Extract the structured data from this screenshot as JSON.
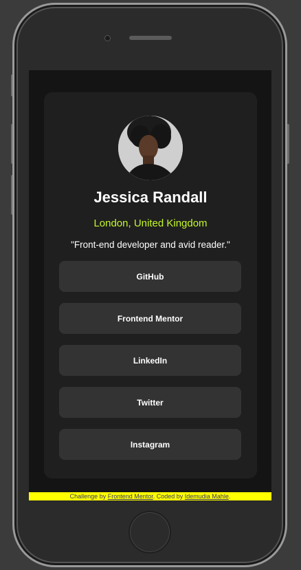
{
  "profile": {
    "name": "Jessica Randall",
    "location": "London, United Kingdom",
    "bio": "\"Front-end developer and avid reader.\""
  },
  "links": [
    {
      "label": "GitHub"
    },
    {
      "label": "Frontend Mentor"
    },
    {
      "label": "LinkedIn"
    },
    {
      "label": "Twitter"
    },
    {
      "label": "Instagram"
    }
  ],
  "footer": {
    "prefix": "Challenge by ",
    "challenge_link": "Frontend Mentor",
    "middle": ". Coded by ",
    "author_link": "Idemudia Mahle",
    "suffix": "."
  },
  "colors": {
    "accent": "#c4f82a",
    "card": "#1f1f1f",
    "button": "#333333",
    "footer_bg": "#ffff00"
  }
}
